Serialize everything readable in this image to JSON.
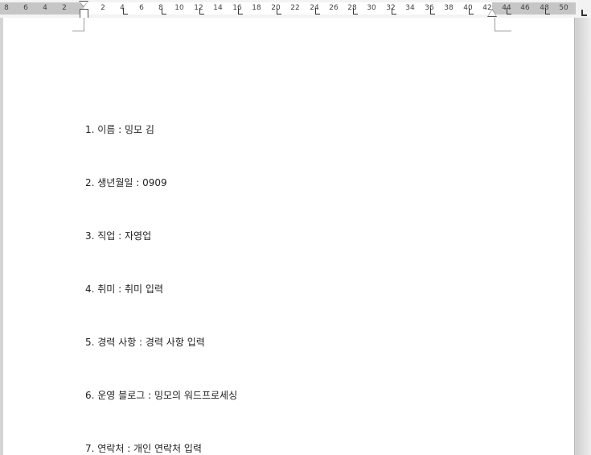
{
  "ruler": {
    "numbers": [
      "8",
      "6",
      "4",
      "2",
      "2",
      "4",
      "6",
      "8",
      "10",
      "12",
      "14",
      "16",
      "18",
      "20",
      "22",
      "24",
      "26",
      "28",
      "30",
      "32",
      "34",
      "36",
      "38",
      "40",
      "42",
      "44",
      "46",
      "48",
      "50"
    ]
  },
  "document": {
    "lines": [
      "1. 이름 : 밍모 김",
      "2. 생년월일 : 0909",
      "3. 직업 : 자영업",
      "4. 취미 : 취미 입력",
      "5. 경력 사항 : 경력 사항 입력",
      "6. 운영 블로그 : 밍모의 워드프로세싱",
      "7. 연락처 : 개인 연락처 입력"
    ]
  }
}
